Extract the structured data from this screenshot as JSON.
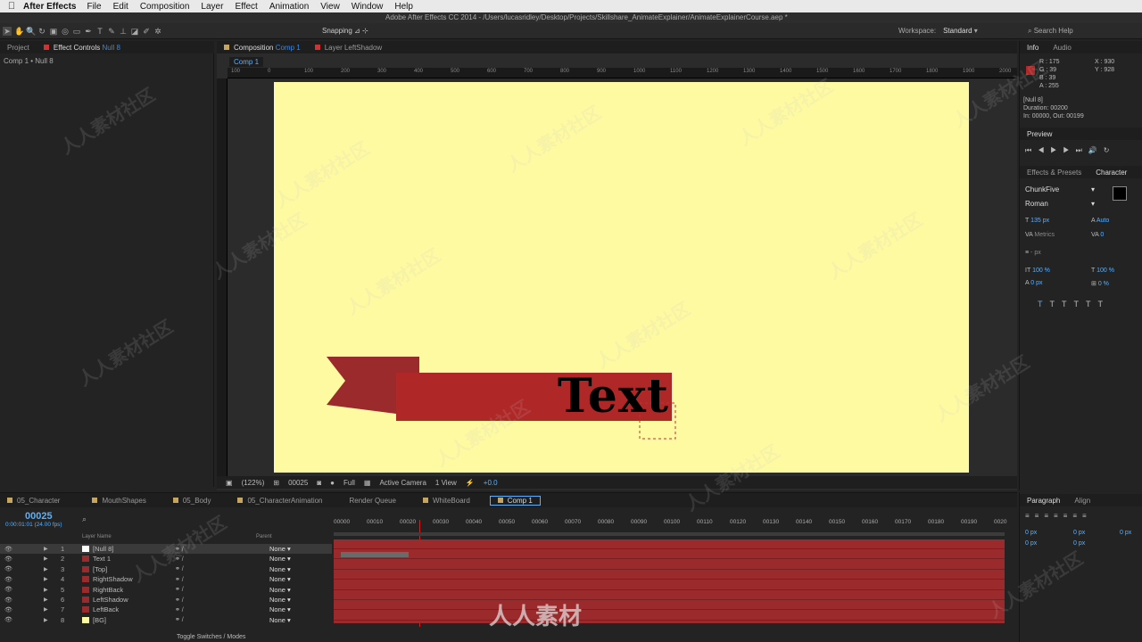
{
  "menubar": {
    "app": "After Effects",
    "items": [
      "File",
      "Edit",
      "Composition",
      "Layer",
      "Effect",
      "Animation",
      "View",
      "Window",
      "Help"
    ]
  },
  "title": "Adobe After Effects CC 2014 - /Users/lucasridley/Desktop/Projects/Skillshare_AnimateExplainer/AnimateExplainerCourse.aep *",
  "toolbar": {
    "snapping": "Snapping",
    "workspace_label": "Workspace:",
    "workspace": "Standard",
    "search": "Search Help"
  },
  "left_panel": {
    "tab_project": "Project",
    "tab_effect_controls": "Effect Controls",
    "effect_target": "Null 8",
    "breadcrumb": "Comp 1 • Null 8"
  },
  "viewer": {
    "tab_composition": "Composition",
    "comp_name": "Comp 1",
    "tab_layer": "Layer LeftShadow",
    "comp_tab": "Comp 1",
    "zoom": "(122%)",
    "timecode": "00025",
    "resolution": "Full",
    "camera": "Active Camera",
    "views": "1 View",
    "exposure": "+0.0",
    "ruler_labels": [
      "100",
      "0",
      "100",
      "200",
      "300",
      "400",
      "500",
      "600",
      "700",
      "800",
      "900",
      "1000",
      "1100",
      "1200",
      "1300",
      "1400",
      "1500",
      "1600",
      "1700",
      "1800",
      "1900",
      "2000"
    ],
    "banner_text": "Text"
  },
  "info": {
    "tab_info": "Info",
    "tab_audio": "Audio",
    "r": "R : 175",
    "g": "G : 39",
    "b": "B : 39",
    "a": "A : 255",
    "x": "X : 930",
    "y": "Y : 928",
    "layer": "[Null 8]",
    "duration": "Duration: 00200",
    "inout": "In: 00000, Out: 00199",
    "swatch": "#af2727"
  },
  "preview": {
    "label": "Preview"
  },
  "character": {
    "tab_effects": "Effects & Presets",
    "tab_character": "Character",
    "font": "ChunkFive",
    "style": "Roman",
    "size": "135 px",
    "leading": "Auto",
    "kerning": "Metrics",
    "tracking": "0",
    "stroke": "- px",
    "vscale": "100 %",
    "hscale": "100 %",
    "baseline": "0 px",
    "tsume": "0 %"
  },
  "timeline": {
    "tabs": [
      "05_Character",
      "MouthShapes",
      "05_Body",
      "05_CharacterAnimation",
      "Render Queue",
      "WhiteBoard",
      "Comp 1"
    ],
    "timecode": "00025",
    "timecode_sub": "0:00:01:01 (24.00 fps)",
    "col_layer_name": "Layer Name",
    "col_parent": "Parent",
    "footer": "Toggle Switches / Modes",
    "ruler": [
      "00000",
      "00010",
      "00020",
      "00030",
      "00040",
      "00050",
      "00060",
      "00070",
      "00080",
      "00090",
      "00100",
      "00110",
      "00120",
      "00130",
      "00140",
      "00150",
      "00160",
      "00170",
      "00180",
      "00190",
      "0020"
    ],
    "layers": [
      {
        "num": "1",
        "name": "[Null 8]",
        "color": "#ffffff",
        "parent": "None"
      },
      {
        "num": "2",
        "name": "Text 1",
        "color": "#9a2a2c",
        "parent": "None"
      },
      {
        "num": "3",
        "name": "[Top]",
        "color": "#9a2a2c",
        "parent": "None"
      },
      {
        "num": "4",
        "name": "RightShadow",
        "color": "#9a2a2c",
        "parent": "None"
      },
      {
        "num": "5",
        "name": "RightBack",
        "color": "#9a2a2c",
        "parent": "None"
      },
      {
        "num": "6",
        "name": "LeftShadow",
        "color": "#9a2a2c",
        "parent": "None"
      },
      {
        "num": "7",
        "name": "LeftBack",
        "color": "#9a2a2c",
        "parent": "None"
      },
      {
        "num": "8",
        "name": "[BG]",
        "color": "#fefaa2",
        "parent": "None"
      }
    ]
  },
  "paragraph": {
    "tab_paragraph": "Paragraph",
    "tab_align": "Align",
    "v1": "0 px",
    "v2": "0 px",
    "v3": "0 px",
    "v4": "0 px",
    "v5": "0 px"
  },
  "watermark": "人人素材社区",
  "logo_text": "人人素材"
}
